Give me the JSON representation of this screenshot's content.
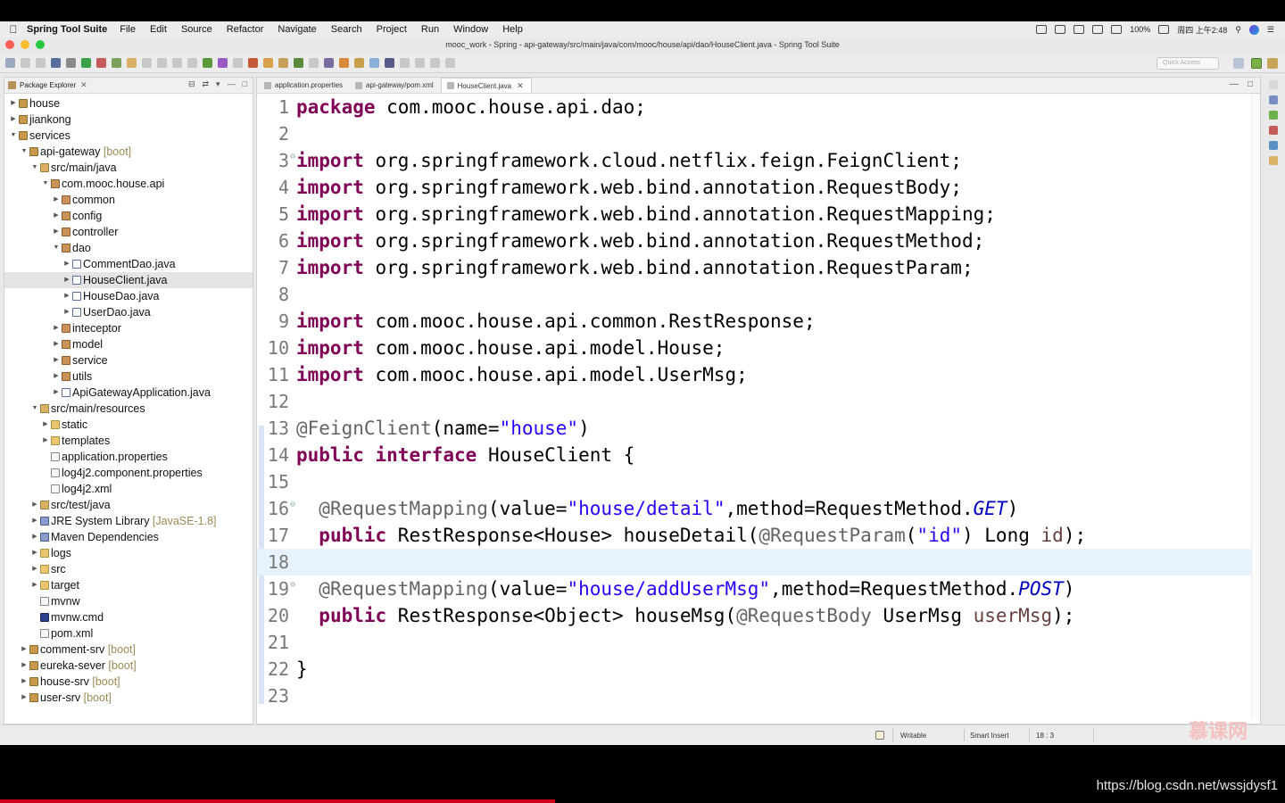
{
  "menubar": {
    "app_name": "Spring Tool Suite",
    "items": [
      "File",
      "Edit",
      "Source",
      "Refactor",
      "Navigate",
      "Search",
      "Project",
      "Run",
      "Window",
      "Help"
    ],
    "battery": "100%",
    "clock": "周四 上午2:48"
  },
  "window": {
    "title": "mooc_work - Spring - api-gateway/src/main/java/com/mooc/house/api/dao/HouseClient.java - Spring Tool Suite"
  },
  "toolbar": {
    "quick_access_placeholder": "Quick Access"
  },
  "package_explorer": {
    "title": "Package Explorer",
    "tree": [
      {
        "depth": 0,
        "arrow": "▶",
        "icon": "project",
        "label": "house"
      },
      {
        "depth": 0,
        "arrow": "▶",
        "icon": "project",
        "label": "jiankong"
      },
      {
        "depth": 0,
        "arrow": "▼",
        "icon": "project",
        "label": "services"
      },
      {
        "depth": 1,
        "arrow": "▼",
        "icon": "project",
        "label": "api-gateway",
        "deco": " [boot]"
      },
      {
        "depth": 2,
        "arrow": "▼",
        "icon": "srcfolder",
        "label": "src/main/java"
      },
      {
        "depth": 3,
        "arrow": "▼",
        "icon": "package",
        "label": "com.mooc.house.api"
      },
      {
        "depth": 4,
        "arrow": "▶",
        "icon": "package",
        "label": "common"
      },
      {
        "depth": 4,
        "arrow": "▶",
        "icon": "package",
        "label": "config"
      },
      {
        "depth": 4,
        "arrow": "▶",
        "icon": "package",
        "label": "controller"
      },
      {
        "depth": 4,
        "arrow": "▼",
        "icon": "package",
        "label": "dao"
      },
      {
        "depth": 5,
        "arrow": "▶",
        "icon": "java",
        "label": "CommentDao.java"
      },
      {
        "depth": 5,
        "arrow": "▶",
        "icon": "java",
        "label": "HouseClient.java",
        "selected": true
      },
      {
        "depth": 5,
        "arrow": "▶",
        "icon": "java",
        "label": "HouseDao.java"
      },
      {
        "depth": 5,
        "arrow": "▶",
        "icon": "java",
        "label": "UserDao.java"
      },
      {
        "depth": 4,
        "arrow": "▶",
        "icon": "package",
        "label": "inteceptor"
      },
      {
        "depth": 4,
        "arrow": "▶",
        "icon": "package",
        "label": "model"
      },
      {
        "depth": 4,
        "arrow": "▶",
        "icon": "package",
        "label": "service"
      },
      {
        "depth": 4,
        "arrow": "▶",
        "icon": "package",
        "label": "utils"
      },
      {
        "depth": 4,
        "arrow": "▶",
        "icon": "java",
        "label": "ApiGatewayApplication.java"
      },
      {
        "depth": 2,
        "arrow": "▼",
        "icon": "srcfolder",
        "label": "src/main/resources"
      },
      {
        "depth": 3,
        "arrow": "▶",
        "icon": "folder",
        "label": "static"
      },
      {
        "depth": 3,
        "arrow": "▶",
        "icon": "folder",
        "label": "templates"
      },
      {
        "depth": 3,
        "arrow": "",
        "icon": "file",
        "label": "application.properties"
      },
      {
        "depth": 3,
        "arrow": "",
        "icon": "file",
        "label": "log4j2.component.properties"
      },
      {
        "depth": 3,
        "arrow": "",
        "icon": "file",
        "label": "log4j2.xml"
      },
      {
        "depth": 2,
        "arrow": "▶",
        "icon": "srcfolder",
        "label": "src/test/java"
      },
      {
        "depth": 2,
        "arrow": "▶",
        "icon": "library",
        "label": "JRE System Library",
        "deco": " [JavaSE-1.8]"
      },
      {
        "depth": 2,
        "arrow": "▶",
        "icon": "library",
        "label": "Maven Dependencies"
      },
      {
        "depth": 2,
        "arrow": "▶",
        "icon": "folder",
        "label": "logs"
      },
      {
        "depth": 2,
        "arrow": "▶",
        "icon": "folder",
        "label": "src"
      },
      {
        "depth": 2,
        "arrow": "▶",
        "icon": "folder",
        "label": "target"
      },
      {
        "depth": 2,
        "arrow": "",
        "icon": "file",
        "label": "mvnw"
      },
      {
        "depth": 2,
        "arrow": "",
        "icon": "cmd",
        "label": "mvnw.cmd"
      },
      {
        "depth": 2,
        "arrow": "",
        "icon": "file",
        "label": "pom.xml"
      },
      {
        "depth": 1,
        "arrow": "▶",
        "icon": "project",
        "label": "comment-srv",
        "deco": " [boot]"
      },
      {
        "depth": 1,
        "arrow": "▶",
        "icon": "project",
        "label": "eureka-sever",
        "deco": " [boot]"
      },
      {
        "depth": 1,
        "arrow": "▶",
        "icon": "project",
        "label": "house-srv",
        "deco": " [boot]"
      },
      {
        "depth": 1,
        "arrow": "▶",
        "icon": "project",
        "label": "user-srv",
        "deco": " [boot]"
      }
    ]
  },
  "editor": {
    "tabs": [
      {
        "label": "application.properties",
        "active": false
      },
      {
        "label": "api-gateway/pom.xml",
        "active": false
      },
      {
        "label": "HouseClient.java",
        "active": true
      }
    ],
    "current_line": 18,
    "lines": [
      [
        [
          "kw",
          "package"
        ],
        [
          "t",
          " com.mooc.house.api.dao;"
        ]
      ],
      [],
      [
        [
          "kw",
          "import"
        ],
        [
          "t",
          " org.springframework.cloud.netflix.feign.FeignClient;"
        ]
      ],
      [
        [
          "kw",
          "import"
        ],
        [
          "t",
          " org.springframework.web.bind.annotation.RequestBody;"
        ]
      ],
      [
        [
          "kw",
          "import"
        ],
        [
          "t",
          " org.springframework.web.bind.annotation.RequestMapping;"
        ]
      ],
      [
        [
          "kw",
          "import"
        ],
        [
          "t",
          " org.springframework.web.bind.annotation.RequestMethod;"
        ]
      ],
      [
        [
          "kw",
          "import"
        ],
        [
          "t",
          " org.springframework.web.bind.annotation.RequestParam;"
        ]
      ],
      [],
      [
        [
          "kw",
          "import"
        ],
        [
          "t",
          " com.mooc.house.api.common.RestResponse;"
        ]
      ],
      [
        [
          "kw",
          "import"
        ],
        [
          "t",
          " com.mooc.house.api.model.House;"
        ]
      ],
      [
        [
          "kw",
          "import"
        ],
        [
          "t",
          " com.mooc.house.api.model.UserMsg;"
        ]
      ],
      [],
      [
        [
          "ann",
          "@FeignClient"
        ],
        [
          "t",
          "(name="
        ],
        [
          "str",
          "\"house\""
        ],
        [
          "t",
          ")"
        ]
      ],
      [
        [
          "kw",
          "public"
        ],
        [
          "t",
          " "
        ],
        [
          "kw",
          "interface"
        ],
        [
          "t",
          " HouseClient {"
        ]
      ],
      [],
      [
        [
          "t",
          "  "
        ],
        [
          "ann",
          "@RequestMapping"
        ],
        [
          "t",
          "(value="
        ],
        [
          "str",
          "\"house/detail\""
        ],
        [
          "t",
          ",method=RequestMethod."
        ],
        [
          "con",
          "GET"
        ],
        [
          "t",
          ")"
        ]
      ],
      [
        [
          "t",
          "  "
        ],
        [
          "kw",
          "public"
        ],
        [
          "t",
          " RestResponse<House> houseDetail("
        ],
        [
          "ann",
          "@RequestParam"
        ],
        [
          "t",
          "("
        ],
        [
          "str",
          "\"id\""
        ],
        [
          "t",
          ") Long "
        ],
        [
          "par",
          "id"
        ],
        [
          "t",
          ");"
        ]
      ],
      [],
      [
        [
          "t",
          "  "
        ],
        [
          "ann",
          "@RequestMapping"
        ],
        [
          "t",
          "(value="
        ],
        [
          "str",
          "\"house/addUserMsg\""
        ],
        [
          "t",
          ",method=RequestMethod."
        ],
        [
          "con",
          "POST"
        ],
        [
          "t",
          ")"
        ]
      ],
      [
        [
          "t",
          "  "
        ],
        [
          "kw",
          "public"
        ],
        [
          "t",
          " RestResponse<Object> houseMsg("
        ],
        [
          "ann",
          "@RequestBody"
        ],
        [
          "t",
          " UserMsg "
        ],
        [
          "par",
          "userMsg"
        ],
        [
          "t",
          ");"
        ]
      ],
      [],
      [
        [
          "t",
          "}"
        ]
      ],
      []
    ],
    "fold_lines": [
      3,
      16,
      19
    ]
  },
  "statusbar": {
    "mode": "Writable",
    "insert": "Smart Insert",
    "position": "18 : 3"
  },
  "watermark": "慕课网",
  "url": "https://blog.csdn.net/wssjdysf1",
  "video_progress": 0.432
}
